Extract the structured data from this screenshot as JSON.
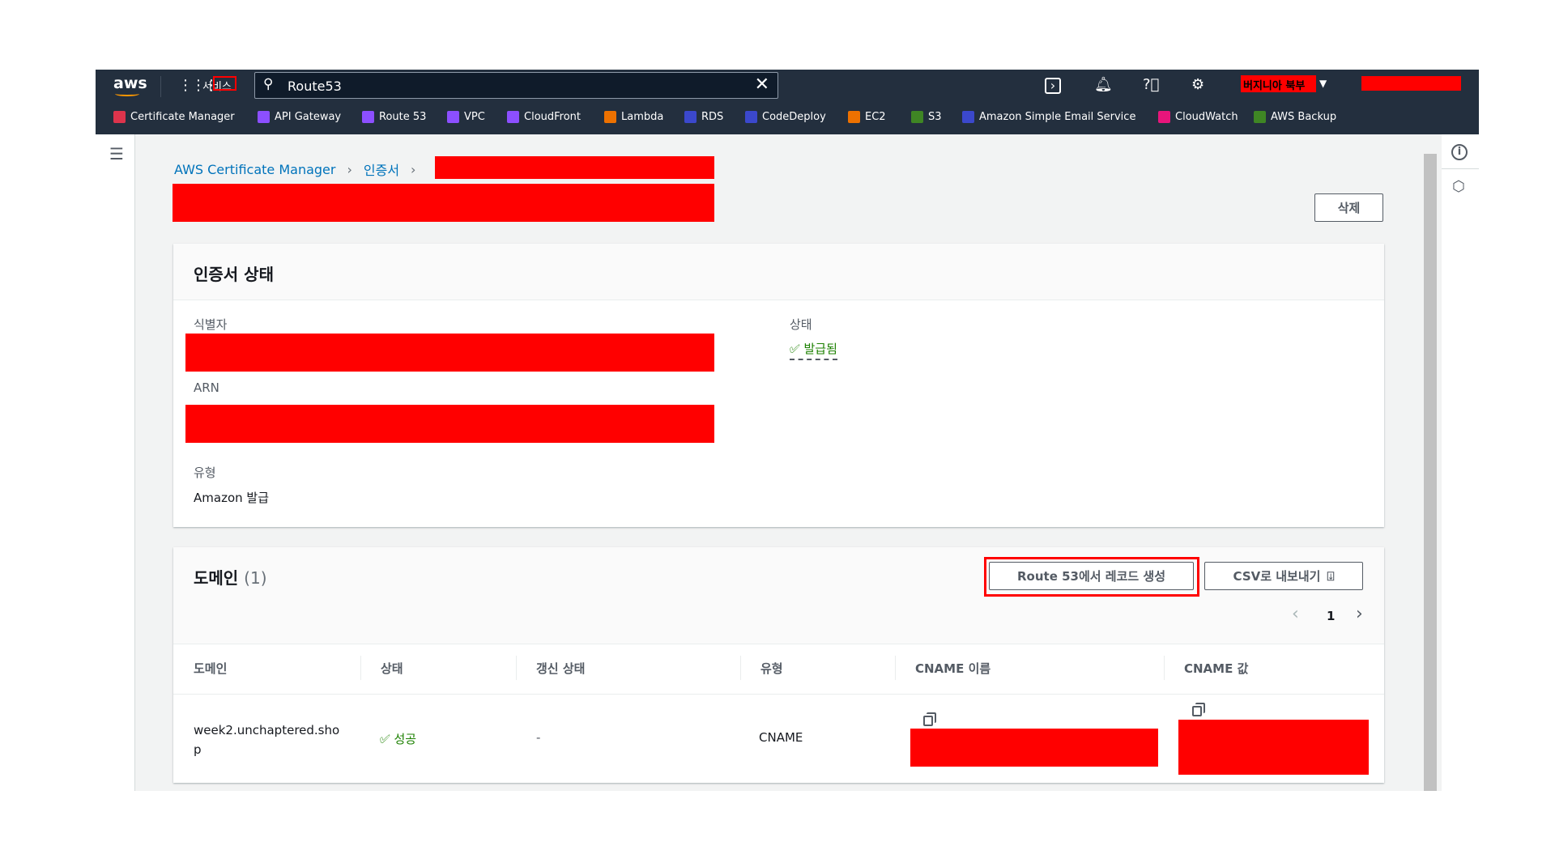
{
  "topnav": {
    "logo": "aws",
    "services": "서비스",
    "search_value": "Route53",
    "region": "버지니아 북부"
  },
  "favorites": [
    {
      "label": "Certificate Manager",
      "color": "#dd344c"
    },
    {
      "label": "API Gateway",
      "color": "#8c4fff"
    },
    {
      "label": "Route 53",
      "color": "#8c4fff"
    },
    {
      "label": "VPC",
      "color": "#8c4fff"
    },
    {
      "label": "CloudFront",
      "color": "#8c4fff"
    },
    {
      "label": "Lambda",
      "color": "#ed7100"
    },
    {
      "label": "RDS",
      "color": "#3b48cc"
    },
    {
      "label": "CodeDeploy",
      "color": "#3b48cc"
    },
    {
      "label": "EC2",
      "color": "#ed7100"
    },
    {
      "label": "S3",
      "color": "#3f8624"
    },
    {
      "label": "Amazon Simple Email Service",
      "color": "#3b48cc"
    },
    {
      "label": "CloudWatch",
      "color": "#e7157b"
    },
    {
      "label": "AWS Backup",
      "color": "#3f8624"
    }
  ],
  "breadcrumb": {
    "root": "AWS Certificate Manager",
    "section": "인증서"
  },
  "delete_label": "삭제",
  "status_card": {
    "title": "인증서 상태",
    "identifier_label": "식별자",
    "arn_label": "ARN",
    "type_label": "유형",
    "type_value": "Amazon 발급",
    "status_label": "상태",
    "status_value": "발급됨"
  },
  "domains": {
    "title": "도메인",
    "count": "(1)",
    "create_record": "Route 53에서 레코드 생성",
    "export_csv": "CSV로 내보내기",
    "page": "1",
    "columns": [
      "도메인",
      "상태",
      "갱신 상태",
      "유형",
      "CNAME 이름",
      "CNAME 값"
    ],
    "rows": [
      {
        "domain_line1": "week2.unchaptered.sho",
        "domain_line2": "p",
        "status": "성공",
        "renewal": "-",
        "type": "CNAME"
      }
    ]
  },
  "colors": {
    "nav": "#232f3e",
    "link": "#0073bb",
    "success": "#1d8102",
    "redaction": "#ff0000"
  }
}
